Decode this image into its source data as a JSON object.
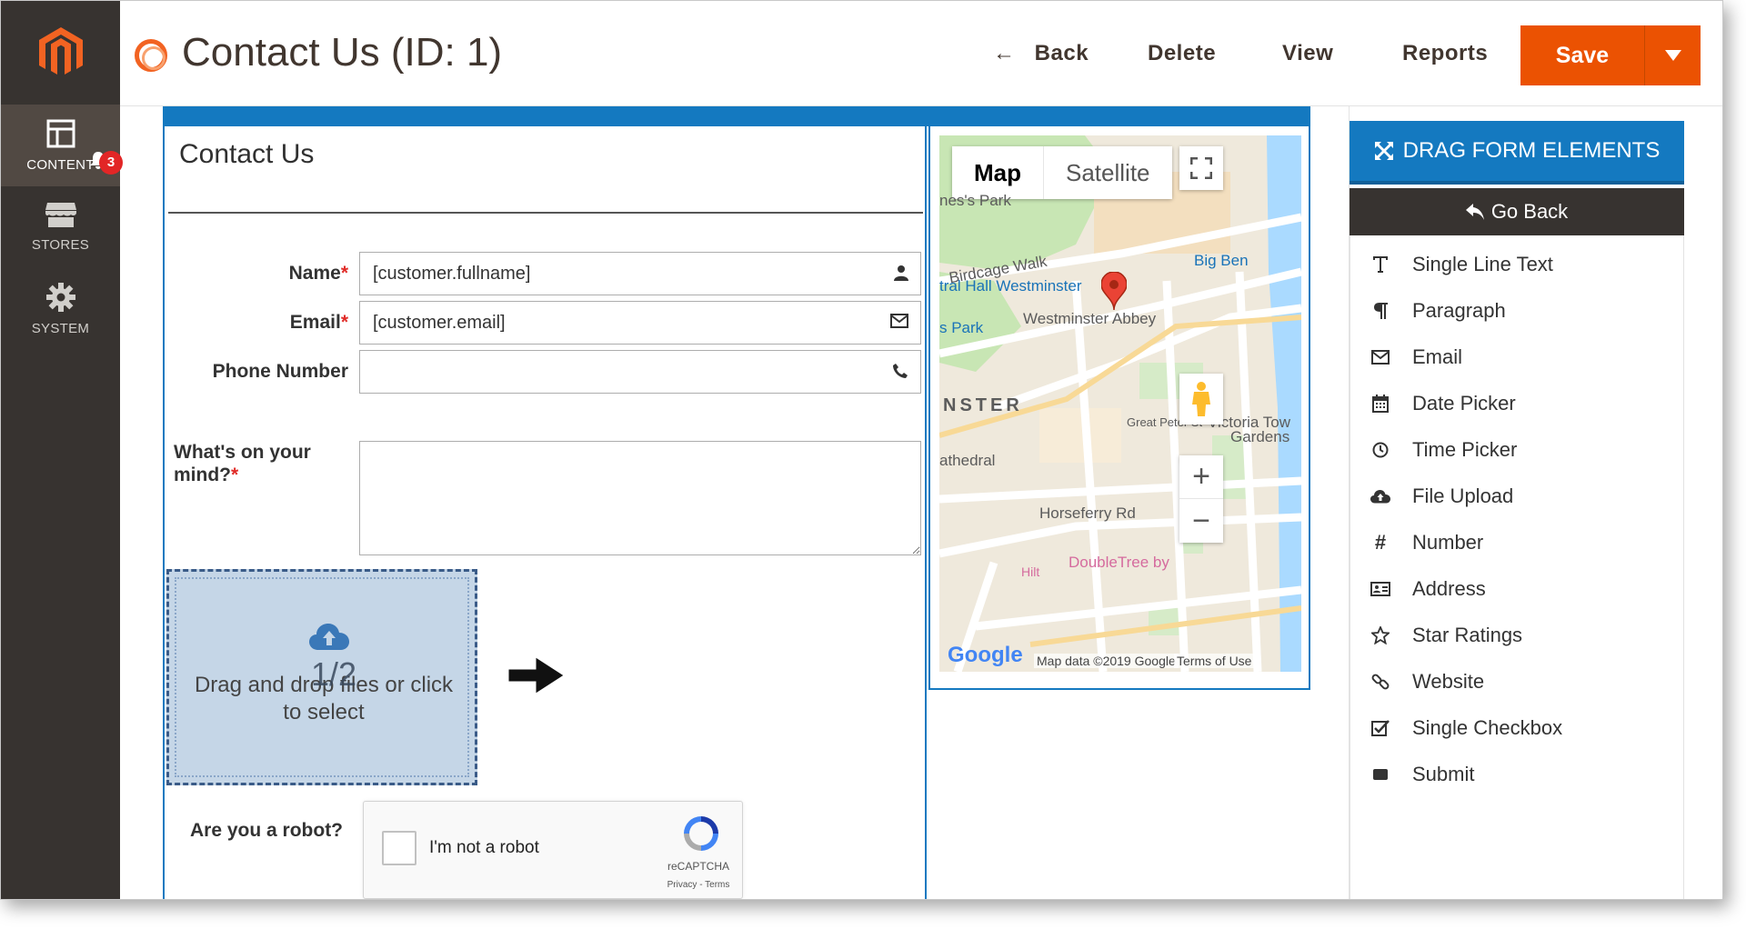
{
  "header": {
    "title": "Contact Us (ID: 1)",
    "back": "Back",
    "delete": "Delete",
    "view": "View",
    "reports": "Reports",
    "save": "Save"
  },
  "sidebar": {
    "items": [
      {
        "label": "CONTENT",
        "badge": "3"
      },
      {
        "label": "STORES"
      },
      {
        "label": "SYSTEM"
      }
    ]
  },
  "form": {
    "heading": "Contact Us",
    "fields": {
      "name": {
        "label": "Name",
        "required": "*",
        "value": "[customer.fullname]",
        "icon": "user-icon"
      },
      "email": {
        "label": "Email",
        "required": "*",
        "value": "[customer.email]",
        "icon": "envelope-icon"
      },
      "phone": {
        "label": "Phone Number",
        "value": "",
        "icon": "phone-icon"
      },
      "mind": {
        "label": "What's on your mind?",
        "required": "*"
      }
    },
    "dropzone": {
      "text": "Drag and drop files or click to select",
      "page_badge": "1/2"
    },
    "robot": {
      "label": "Are you a robot?",
      "checkbox_text": "I'm not a robot",
      "brand": "reCAPTCHA",
      "links": "Privacy - Terms"
    }
  },
  "map": {
    "tab_map": "Map",
    "tab_satellite": "Satellite",
    "labels": {
      "park": "nes's Park",
      "birdcage": "Birdcage Walk",
      "bigben": "Big Ben",
      "hall": "tral Hall Westminster",
      "abbey": "Westminster Abbey",
      "spark": "s Park",
      "nster": "NSTER",
      "cathedral": "athedral",
      "victoria": "Victoria Tow",
      "gardens": "Gardens",
      "horseferry": "Horseferry Rd",
      "greatpeter": "Great Peter St",
      "doubletree": "DoubleTree by",
      "hilt": "Hilt"
    },
    "attribution": "Map data ©2019 Google",
    "terms": "Terms of Use",
    "google": "Google"
  },
  "panel": {
    "title": "DRAG FORM ELEMENTS",
    "go_back": "Go Back",
    "items": [
      {
        "label": "Single Line Text",
        "icon": "text-icon"
      },
      {
        "label": "Paragraph",
        "icon": "paragraph-icon"
      },
      {
        "label": "Email",
        "icon": "envelope-icon"
      },
      {
        "label": "Date Picker",
        "icon": "calendar-icon"
      },
      {
        "label": "Time Picker",
        "icon": "clock-icon"
      },
      {
        "label": "File Upload",
        "icon": "cloud-upload-icon"
      },
      {
        "label": "Number",
        "icon": "hash-icon"
      },
      {
        "label": "Address",
        "icon": "address-card-icon"
      },
      {
        "label": "Star Ratings",
        "icon": "star-icon"
      },
      {
        "label": "Website",
        "icon": "link-icon"
      },
      {
        "label": "Single Checkbox",
        "icon": "checkbox-icon"
      },
      {
        "label": "Submit",
        "icon": "submit-icon"
      }
    ]
  },
  "colors": {
    "accent": "#eb5202",
    "blue": "#1479c0",
    "sidebar": "#373330"
  }
}
